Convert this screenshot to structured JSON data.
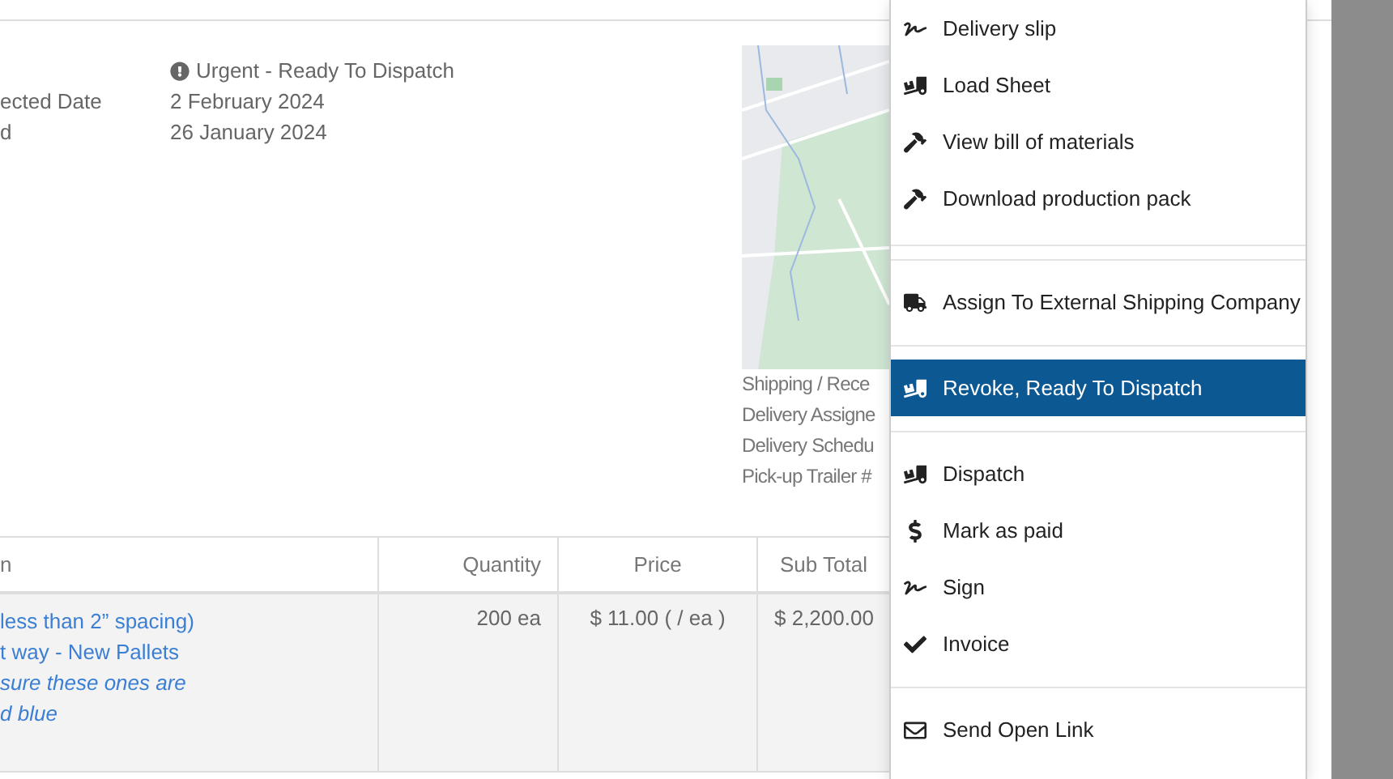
{
  "order_info": [
    {
      "value": "Urgent - Ready To Dispatch",
      "kind": "status"
    },
    {
      "label": "ected Date",
      "value": "2 February 2024",
      "kind": "text"
    },
    {
      "label": "d",
      "value": "26 January 2024",
      "kind": "text"
    }
  ],
  "shipping_labels": [
    "Shipping / Rece",
    "Delivery Assigne",
    "Delivery Schedu",
    "Pick-up Trailer #"
  ],
  "table": {
    "columns": [
      "n",
      "Quantity",
      "Price",
      "Sub Total"
    ],
    "rows": [
      {
        "description": [
          {
            "text": "less than 2” spacing)",
            "italic": false
          },
          {
            "text": "t way - New Pallets",
            "italic": false
          },
          {
            "text": "sure these ones are",
            "italic": true
          },
          {
            "text": "d blue",
            "italic": true
          }
        ],
        "quantity": "200 ea",
        "price": "$ 11.00 ( / ea )",
        "sub_total": "$ 2,200.00"
      }
    ]
  },
  "menu": {
    "sections": [
      [
        {
          "label": "Delivery slip",
          "kind": "signature",
          "selected": false
        },
        {
          "label": "Load Sheet",
          "kind": "dolly",
          "selected": false
        },
        {
          "label": "View bill of materials",
          "kind": "hammer",
          "selected": false
        },
        {
          "label": "Download production pack",
          "kind": "hammer",
          "selected": false
        }
      ],
      [
        {
          "label": "Assign To External Shipping Company",
          "kind": "truck",
          "selected": false
        }
      ],
      [
        {
          "label": "Revoke, Ready To Dispatch",
          "kind": "dolly",
          "selected": true
        }
      ],
      [
        {
          "label": "Dispatch",
          "kind": "dolly",
          "selected": false
        },
        {
          "label": "Mark as paid",
          "kind": "dollar",
          "selected": false
        },
        {
          "label": "Sign",
          "kind": "signature",
          "selected": false
        },
        {
          "label": "Invoice",
          "kind": "check",
          "selected": false
        }
      ],
      [
        {
          "label": "Send Open Link",
          "kind": "envelope",
          "selected": false
        }
      ]
    ]
  }
}
